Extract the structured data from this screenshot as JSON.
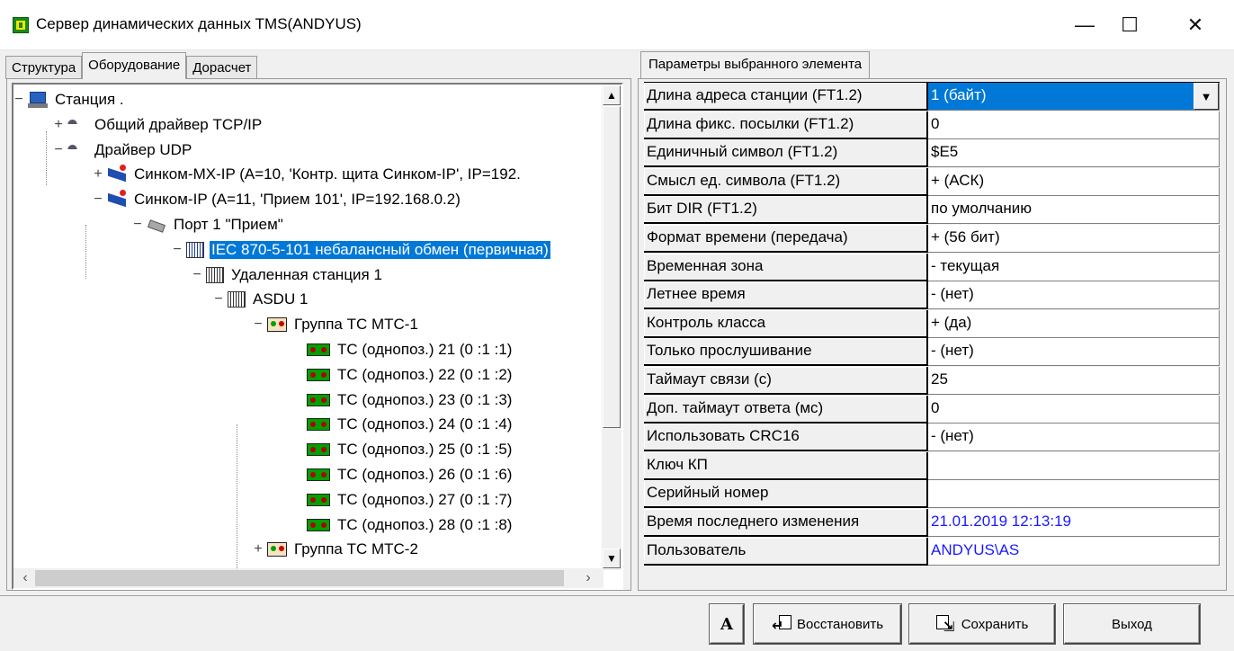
{
  "window": {
    "title": "Сервер динамических данных TMS(ANDYUS)",
    "minimize": "—",
    "maximize": "☐",
    "close": "✕"
  },
  "left_tabs": [
    "Структура",
    "Оборудование",
    "Дорасчет"
  ],
  "tree": [
    {
      "label": "Станция .",
      "expander": "−",
      "icon": "station-icon"
    },
    {
      "label": "Общий драйвер TCP/IP",
      "expander": "+",
      "icon": "network-icon"
    },
    {
      "label": "Драйвер UDP",
      "expander": "−",
      "icon": "network-icon"
    },
    {
      "label": "Синком-MX-IP (A=10, 'Контр. щита Синком-IP', IP=192.",
      "expander": "+",
      "icon": "device-icon"
    },
    {
      "label": "Синком-IP (A=11, 'Прием 101', IP=192.168.0.2)",
      "expander": "−",
      "icon": "device-icon"
    },
    {
      "label": "Порт 1 \"Прием\"",
      "expander": "−",
      "icon": "port-icon"
    },
    {
      "label": "IEC 870-5-101 небалансный обмен (первичная)",
      "expander": "−",
      "icon": "protocol-icon",
      "selected": true
    },
    {
      "label": "Удаленная станция 1",
      "expander": "−",
      "icon": "rack-icon"
    },
    {
      "label": "ASDU 1",
      "expander": "−",
      "icon": "rack-icon"
    },
    {
      "label": "Группа ТС МТС-1",
      "expander": "−",
      "icon": "group-icon"
    },
    {
      "label": "ТС (однопоз.) 21 (0 :1 :1)",
      "icon": "ts-icon"
    },
    {
      "label": "ТС (однопоз.) 22 (0 :1 :2)",
      "icon": "ts-icon"
    },
    {
      "label": "ТС (однопоз.) 23 (0 :1 :3)",
      "icon": "ts-icon"
    },
    {
      "label": "ТС (однопоз.) 24 (0 :1 :4)",
      "icon": "ts-icon"
    },
    {
      "label": "ТС (однопоз.) 25 (0 :1 :5)",
      "icon": "ts-icon"
    },
    {
      "label": "ТС (однопоз.) 26 (0 :1 :6)",
      "icon": "ts-icon"
    },
    {
      "label": "ТС (однопоз.) 27 (0 :1 :7)",
      "icon": "ts-icon"
    },
    {
      "label": "ТС (однопоз.) 28 (0 :1 :8)",
      "icon": "ts-icon"
    },
    {
      "label": "Группа ТС МТС-2",
      "expander": "+",
      "icon": "group-icon"
    }
  ],
  "right_tab": "Параметры выбранного элемента",
  "params": [
    {
      "name": "Длина адреса станции (FT1.2)",
      "value": "1 (байт)"
    },
    {
      "name": "Длина фикс. посылки (FT1.2)",
      "value": "0"
    },
    {
      "name": "Единичный символ (FT1.2)",
      "value": "$E5"
    },
    {
      "name": "Смысл ед. символа (FT1.2)",
      "value": "+ (АСК)"
    },
    {
      "name": "Бит DIR (FT1.2)",
      "value": "по умолчанию"
    },
    {
      "name": "Формат времени (передача)",
      "value": "+ (56 бит)"
    },
    {
      "name": "Временная зона",
      "value": "- текущая"
    },
    {
      "name": "Летнее время",
      "value": "- (нет)"
    },
    {
      "name": "Контроль класса",
      "value": "+ (да)"
    },
    {
      "name": "Только прослушивание",
      "value": "- (нет)"
    },
    {
      "name": "Таймаут связи (с)",
      "value": "25"
    },
    {
      "name": "Доп. таймаут ответа (мс)",
      "value": "0"
    },
    {
      "name": "Использовать CRC16",
      "value": "- (нет)"
    },
    {
      "name": "Ключ КП",
      "value": ""
    },
    {
      "name": "Серийный номер",
      "value": ""
    },
    {
      "name": "Время последнего изменения",
      "value": "21.01.2019 12:13:19"
    },
    {
      "name": "Пользователь",
      "value": "ANDYUS\\AS"
    }
  ],
  "buttons": {
    "font": "A",
    "restore": "Восстановить",
    "save": "Сохранить",
    "exit": "Выход"
  },
  "colors": {
    "selection": "#0078d7",
    "link_value": "#1a1aff"
  }
}
